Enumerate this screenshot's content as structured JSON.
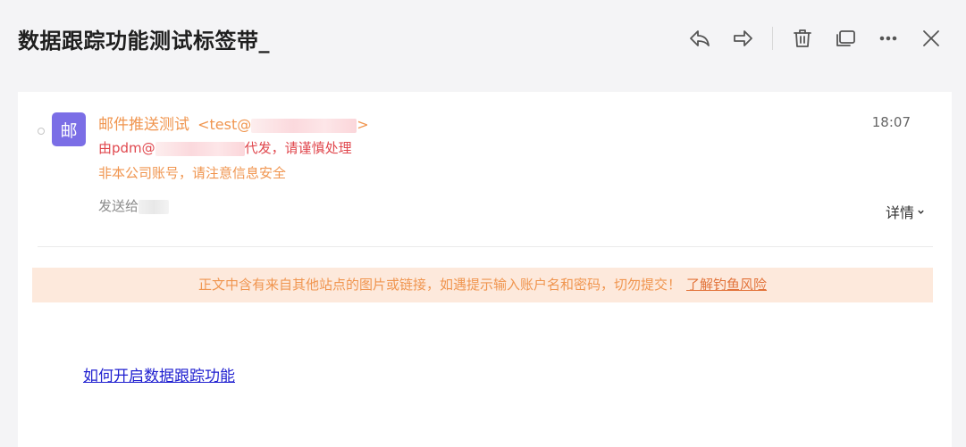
{
  "header": {
    "subject": "数据跟踪功能测试标签带_"
  },
  "toolbar": {
    "icons": [
      "reply-icon",
      "forward-icon",
      "trash-icon",
      "new-window-icon",
      "more-icon",
      "close-icon"
    ]
  },
  "message": {
    "avatar_char": "邮",
    "avatar_color": "#7b6ee6",
    "sender_name": "邮件推送测试",
    "sender_addr_prefix": "<test@",
    "sender_addr_suffix": ">",
    "time": "18:07",
    "proxy_prefix": "由pdm@",
    "proxy_suffix": "代发，请谨慎处理",
    "warning": "非本公司账号，请注意信息安全",
    "to_label": "发送给",
    "detail_label": "详情"
  },
  "phishing_banner": {
    "text": "正文中含有来自其他站点的图片或链接，如遇提示输入账户名和密码，切勿提交！",
    "link": "了解钓鱼风险"
  },
  "body": {
    "link_text": "如何开启数据跟踪功能"
  },
  "colors": {
    "accent_orange": "#f0954f",
    "alert_red": "#e0474d",
    "banner_bg": "#fde9dc",
    "link_blue": "#2020d0"
  }
}
